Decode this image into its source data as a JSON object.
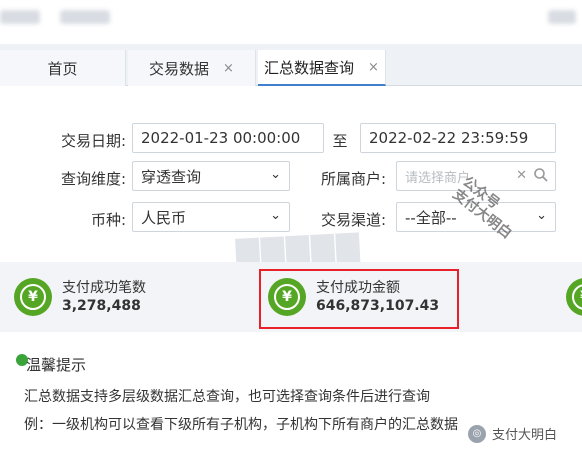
{
  "tabs": [
    {
      "label": "首页",
      "closable": false,
      "active": false
    },
    {
      "label": "交易数据",
      "closable": true,
      "active": false
    },
    {
      "label": "汇总数据查询",
      "closable": true,
      "active": true
    }
  ],
  "tab_close_glyph": "×",
  "form": {
    "date_label": "交易日期:",
    "date_from": "2022-01-23  00:00:00",
    "to_label": "至",
    "date_to": "2022-02-22  23:59:59",
    "dimension_label": "查询维度:",
    "dimension_value": "穿透查询",
    "merchant_label": "所属商户:",
    "merchant_placeholder": "请选择商户",
    "currency_label": "币种:",
    "currency_value": "人民币",
    "channel_label": "交易渠道:",
    "channel_value": "--全部--"
  },
  "stats": [
    {
      "label": "支付成功笔数",
      "value": "3,278,488"
    },
    {
      "label": "支付成功金额",
      "value": "646,873,107.43"
    }
  ],
  "stat_icon_glyph": "¥",
  "tip": {
    "title": "温馨提示",
    "line1": "汇总数据支持多层级数据汇总查询，也可选择查询条件后进行查询",
    "line2": "例：一级机构可以查看下级所有子机构，子机构下所有商户的汇总数据"
  },
  "watermarks": {
    "stamp_line1": "公众号",
    "stamp_line2": "支付大明白",
    "brand": "支付大明白"
  },
  "colors": {
    "accent": "#3f7fce",
    "success_icon": "#55a624",
    "highlight": "#e8202a"
  }
}
